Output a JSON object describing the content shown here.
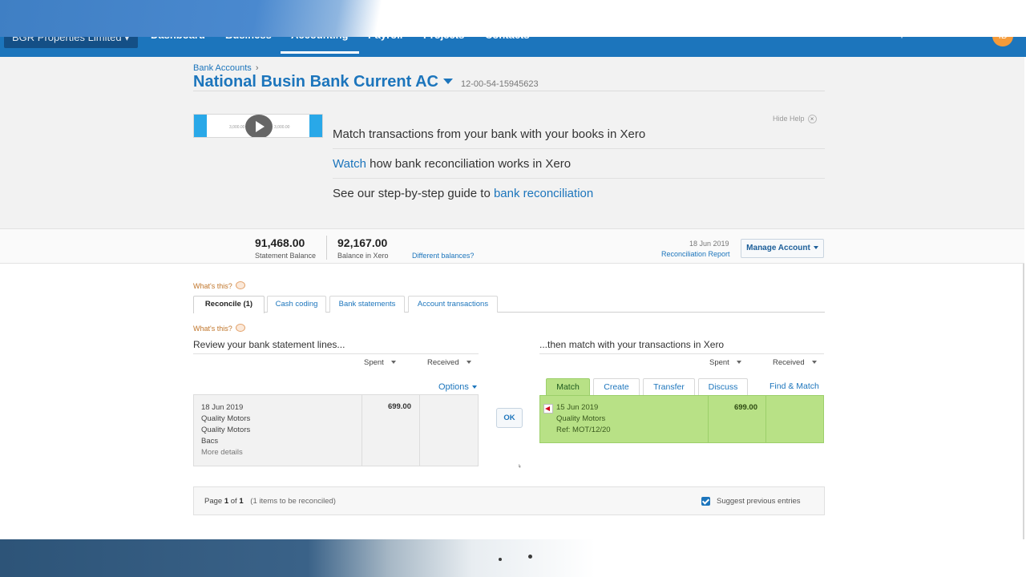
{
  "nav": {
    "org": "BGR Properties Limited",
    "items": [
      {
        "label": "Dashboard",
        "active": false
      },
      {
        "label": "Business",
        "active": false
      },
      {
        "label": "Accounting",
        "active": true
      },
      {
        "label": "Payroll",
        "active": false
      },
      {
        "label": "Projects",
        "active": false
      },
      {
        "label": "Contacts",
        "active": false
      }
    ],
    "icons": [
      "plus-icon",
      "search-icon",
      "bell-icon",
      "help-icon"
    ],
    "avatar_initials": "IB"
  },
  "account": {
    "breadcrumb": "Bank Accounts",
    "breadcrumb_sep": "›",
    "title": "National Busin Bank Current AC",
    "number": "12-00-54-15945623"
  },
  "help": {
    "hide_label": "Hide Help",
    "close_glyph": "×",
    "thumb_mini_left": "3,000.00",
    "thumb_mini_right": "3,000.00",
    "line1": "Match transactions from your bank with your books in Xero",
    "line2_link": "Watch",
    "line2_rest": " how bank reconciliation works in Xero",
    "line3_text": "See our step-by-step guide to ",
    "line3_link": "bank reconciliation"
  },
  "balances": {
    "statement_value": "91,468.00",
    "statement_label": "Statement Balance",
    "xero_value": "92,167.00",
    "xero_label": "Balance in Xero",
    "different_link": "Different balances?",
    "report_date": "18 Jun 2019",
    "report_link": "Reconciliation Report",
    "manage_button": "Manage Account"
  },
  "reconcile": {
    "whats_this": "What's this?",
    "tabs": [
      {
        "label": "Reconcile (1)",
        "active": true
      },
      {
        "label": "Cash coding",
        "active": false
      },
      {
        "label": "Bank statements",
        "active": false
      },
      {
        "label": "Account transactions",
        "active": false
      }
    ],
    "left_heading": "Review your bank statement lines...",
    "right_heading": "...then match with your transactions in Xero",
    "spent_label": "Spent",
    "received_label": "Received",
    "options_link": "Options",
    "statement_line": {
      "date": "18 Jun 2019",
      "payee": "Quality Motors",
      "reference": "Quality Motors",
      "type": "Bacs",
      "more": "More details",
      "spent": "699.00"
    },
    "ok_button": "OK",
    "match_tabs": [
      {
        "label": "Match",
        "active": true
      },
      {
        "label": "Create",
        "active": false
      },
      {
        "label": "Transfer",
        "active": false
      },
      {
        "label": "Discuss",
        "active": false
      }
    ],
    "find_match": "Find & Match",
    "matched_line": {
      "date": "15 Jun 2019",
      "payee": "Quality Motors",
      "reference": "Ref: MOT/12/20",
      "spent": "699.00"
    }
  },
  "footer": {
    "page_prefix": "Page",
    "page_current": "1",
    "page_of": "of",
    "page_total": "1",
    "page_note": "(1 items to be reconciled)",
    "suggest_label": "Suggest previous entries",
    "suggest_checked": true
  },
  "colors": {
    "nav_blue": "#1c75bc",
    "link_blue": "#1c75bc",
    "match_green": "#b8e186"
  }
}
